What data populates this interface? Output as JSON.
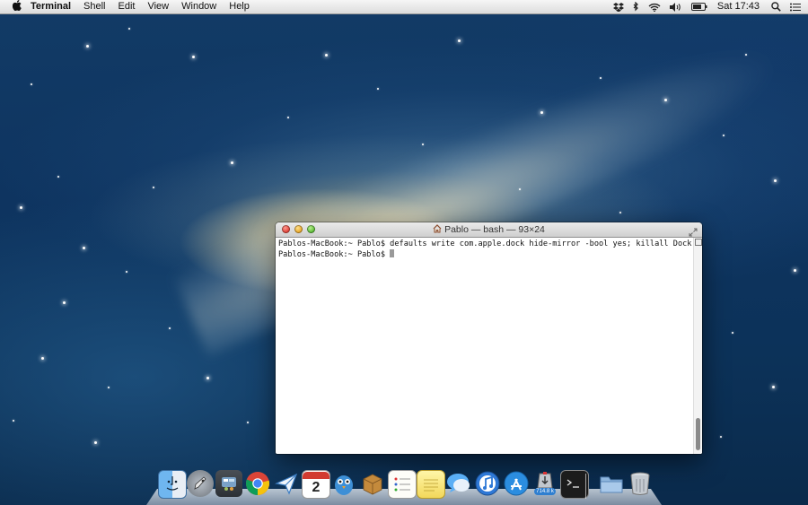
{
  "menubar": {
    "apple": "",
    "app_name": "Terminal",
    "items": [
      "Shell",
      "Edit",
      "View",
      "Window",
      "Help"
    ],
    "clock": "Sat 17:43",
    "status_icons": [
      "dropbox-icon",
      "bluetooth-icon",
      "wifi-icon",
      "volume-icon",
      "battery-icon",
      "spotlight-icon",
      "notification-center-icon"
    ]
  },
  "terminal": {
    "title": "Pablo — bash — 93×24",
    "lines": [
      "Pablos-MacBook:~ Pablo$ defaults write com.apple.dock hide-mirror -bool yes; killall Dock",
      "Pablos-MacBook:~ Pablo$ "
    ]
  },
  "dock": {
    "calendar_day": "2",
    "download_badge": "714.8 k",
    "icons": [
      "finder-icon",
      "launchpad-icon",
      "dashboard-icon",
      "chrome-icon",
      "mail-sparrow-icon",
      "calendar-icon",
      "tweetbot-icon",
      "archive-icon",
      "reminders-icon",
      "notes-icon",
      "messages-icon",
      "itunes-icon",
      "app-store-icon",
      "downloads-icon",
      "terminal-icon",
      "folder-icon",
      "trash-icon"
    ]
  },
  "colors": {
    "menubar": "#e6e6e6",
    "wallpaper": "#0e3460",
    "close": "#e0443a",
    "minimize": "#e9a82b",
    "maximize": "#5fbd3a"
  }
}
